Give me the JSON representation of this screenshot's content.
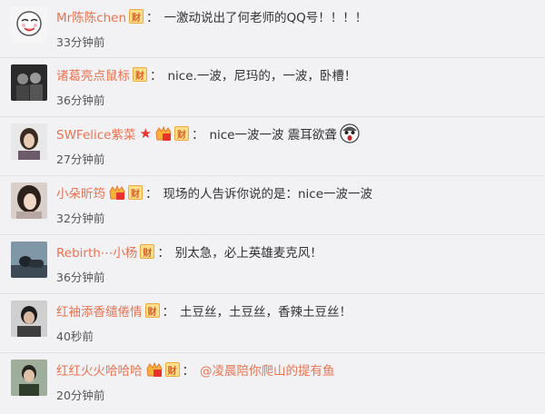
{
  "comments": [
    {
      "name": "Mr陈陈chen",
      "badge": "财",
      "text": "一激动说出了何老师的QQ号！！！！",
      "time": "33分钟前"
    },
    {
      "name": "诸葛亮点鼠标",
      "badge": "财",
      "text": "nice.一波，尼玛的，一波，卧槽！",
      "time": "36分钟前"
    },
    {
      "name": "SWFelice紫菜",
      "badge": "财",
      "text": "nice一波一波 震耳欲聋",
      "time": "27分钟前",
      "emoji_icon": "shocked-face-emoji"
    },
    {
      "name": "小朵昕筠",
      "badge": "财",
      "text": "现场的人告诉你说的是：nice一波一波",
      "time": "32分钟前"
    },
    {
      "name": "Rebirth⋯小杨",
      "badge": "财",
      "text": "别太急，必上英雄麦克风！",
      "time": "36分钟前"
    },
    {
      "name": "红袖添香缱倦情",
      "badge": "财",
      "text": "土豆丝，土豆丝，香辣土豆丝！",
      "time": "40秒前"
    },
    {
      "name": "红红火火哈哈哈",
      "badge": "财",
      "text": "@凌晨陪你爬山的提有鱼",
      "time": "20分钟前"
    }
  ],
  "colon": "："
}
